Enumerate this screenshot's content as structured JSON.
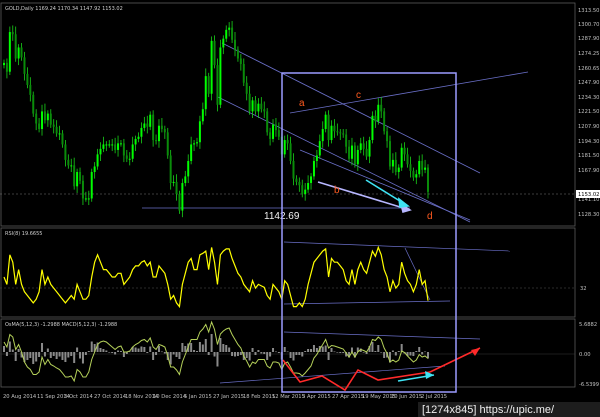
{
  "chart_data": [
    {
      "type": "candlestick",
      "header": "GOLD,Daily  1169.24 1170.34 1147.92 1153.02",
      "y_ticks": [
        "1313.50",
        "1300.70",
        "1287.90",
        "1274.25",
        "1260.65",
        "1247.90",
        "1234.30",
        "1221.50",
        "1207.90",
        "1194.30",
        "1181.50",
        "1167.90",
        "1153.02",
        "1141.10",
        "1128.30"
      ],
      "current_price": "1153.02",
      "ylim": [
        1122,
        1318
      ],
      "annotation_price": "1142.69",
      "wave_labels": [
        "a",
        "b",
        "c",
        "d"
      ],
      "series": [
        {
          "name": "GOLD",
          "close": [
            1270,
            1262,
            1298,
            1296,
            1274,
            1284,
            1275,
            1260,
            1250,
            1241,
            1224,
            1215,
            1210,
            1226,
            1218,
            1224,
            1214,
            1212,
            1206,
            1206,
            1196,
            1182,
            1177,
            1177,
            1158,
            1171,
            1163,
            1147,
            1147,
            1147,
            1171,
            1176,
            1187,
            1192,
            1196,
            1196,
            1196,
            1196,
            1191,
            1197,
            1197,
            1186,
            1183,
            1183,
            1196,
            1201,
            1203,
            1211,
            1215,
            1212,
            1223,
            1200,
            1199,
            1213,
            1210,
            1207,
            1186,
            1161,
            1162,
            1151,
            1136,
            1161,
            1167,
            1181,
            1196,
            1197,
            1198,
            1217,
            1228,
            1258,
            1242,
            1290,
            1268,
            1232,
            1284,
            1292,
            1300,
            1302,
            1291,
            1282,
            1274,
            1269,
            1252,
            1242,
            1226,
            1236,
            1226,
            1233,
            1228,
            1226,
            1207,
            1201,
            1214,
            1209,
            1203,
            1187,
            1200,
            1197,
            1181,
            1165,
            1162,
            1159,
            1151,
            1155,
            1161,
            1167,
            1181,
            1186,
            1199,
            1210,
            1223,
            1200,
            1213,
            1208,
            1207,
            1206,
            1205,
            1194,
            1183,
            1195,
            1178,
            1191,
            1197,
            1192,
            1185,
            1200,
            1222,
            1217,
            1232,
            1226,
            1208,
            1199,
            1176,
            1182,
            1171,
            1175,
            1193,
            1187,
            1178,
            1172,
            1166,
            1169,
            1181,
            1173,
            1175,
            1153
          ]
        }
      ],
      "x_ticks": [
        "20 Aug 2014",
        "11 Sep 2014",
        "3 Oct 2014",
        "27 Oct 2014",
        "18 Nov 2014",
        "10 Dec 2014",
        "5 Jan 2015",
        "27 Jan 2015",
        "18 Feb 2015",
        "12 Mar 2015",
        "3 Apr 2015",
        "27 Apr 2015",
        "19 May 2015",
        "10 Jun 2015",
        "2 Jul 2015"
      ]
    },
    {
      "type": "line",
      "header": "RSI(8) 19.6655",
      "level": "32",
      "ylim": [
        0,
        100
      ],
      "series": [
        {
          "name": "RSI(8)",
          "values": [
            50,
            40,
            80,
            70,
            40,
            60,
            40,
            30,
            25,
            20,
            15,
            20,
            30,
            60,
            40,
            50,
            40,
            35,
            30,
            25,
            20,
            15,
            20,
            25,
            20,
            40,
            30,
            20,
            20,
            25,
            50,
            70,
            80,
            70,
            60,
            60,
            55,
            50,
            50,
            55,
            55,
            40,
            45,
            50,
            60,
            65,
            65,
            70,
            72,
            65,
            70,
            50,
            50,
            65,
            60,
            55,
            40,
            20,
            25,
            15,
            10,
            40,
            55,
            70,
            75,
            60,
            60,
            80,
            82,
            85,
            60,
            90,
            70,
            40,
            80,
            85,
            88,
            88,
            75,
            65,
            55,
            50,
            40,
            35,
            30,
            45,
            35,
            40,
            38,
            36,
            25,
            20,
            40,
            35,
            30,
            20,
            45,
            40,
            25,
            10,
            10,
            15,
            10,
            20,
            40,
            55,
            70,
            75,
            80,
            85,
            88,
            50,
            75,
            70,
            70,
            65,
            60,
            45,
            40,
            60,
            40,
            60,
            70,
            60,
            55,
            70,
            85,
            78,
            90,
            80,
            60,
            50,
            30,
            45,
            35,
            40,
            70,
            55,
            45,
            40,
            30,
            40,
            60,
            40,
            45,
            18
          ]
        }
      ]
    },
    {
      "type": "histogram",
      "header": "OsMA(5,12,3) -1.2988  MACD(5,12,3) -1.2988",
      "y_ticks": [
        "5.6882",
        "0.00",
        "-6.5399"
      ],
      "ylim": [
        -6.8,
        6.0
      ],
      "series": [
        {
          "name": "OsMA",
          "values": [
            1.2,
            -0.8,
            2.1,
            0.5,
            -1.8,
            0.6,
            -1.1,
            -2.0,
            -1.6,
            -1.2,
            -2.4,
            -1.9,
            -1.0,
            1.8,
            -0.9,
            0.7,
            -1.2,
            -0.8,
            -1.4,
            -0.9,
            -1.6,
            -2.0,
            -1.1,
            -0.8,
            -2.2,
            0.9,
            -1.3,
            -2.3,
            -0.6,
            0.2,
            2.1,
            1.6,
            1.9,
            0.8,
            0.6,
            0.3,
            -0.1,
            -0.2,
            -0.5,
            0.3,
            0.2,
            -1.0,
            -0.4,
            0.1,
            1.0,
            0.9,
            0.7,
            1.1,
            1.0,
            -0.2,
            1.1,
            -1.6,
            -0.6,
            1.2,
            0.1,
            -0.3,
            -1.6,
            -2.5,
            -0.5,
            -1.0,
            -1.4,
            1.8,
            1.2,
            1.7,
            1.8,
            0.4,
            0.2,
            2.0,
            1.5,
            2.6,
            -0.6,
            3.6,
            -0.9,
            -2.9,
            2.8,
            1.6,
            1.4,
            0.9,
            -0.8,
            -0.9,
            -0.8,
            -0.6,
            -1.6,
            -1.2,
            -1.7,
            0.8,
            -0.6,
            0.4,
            -0.3,
            -0.4,
            -1.6,
            -0.9,
            0.8,
            0.1,
            -0.2,
            -1.5,
            1.0,
            0.1,
            -1.2,
            -1.7,
            -0.6,
            -0.6,
            -0.9,
            0.2,
            0.6,
            0.6,
            1.4,
            0.8,
            1.2,
            1.1,
            1.3,
            -1.6,
            0.8,
            0.1,
            0.0,
            -0.2,
            -0.2,
            -0.9,
            -1.1,
            0.9,
            -1.1,
            0.9,
            0.7,
            -0.1,
            -0.4,
            1.2,
            2.0,
            0.2,
            1.4,
            0.0,
            -1.2,
            -1.1,
            -2.1,
            0.3,
            -0.7,
            0.2,
            1.6,
            -0.3,
            -0.8,
            -0.7,
            -0.8,
            0.2,
            1.0,
            -0.5,
            0.1,
            -1.3
          ]
        },
        {
          "name": "MACD",
          "values": [
            2.0,
            1.0,
            3.5,
            3.0,
            0.5,
            1.5,
            0.0,
            -2.0,
            -3.0,
            -3.5,
            -4.5,
            -4.5,
            -4.0,
            -1.0,
            -2.5,
            -1.5,
            -2.5,
            -2.8,
            -3.2,
            -3.5,
            -4.2,
            -5.0,
            -5.0,
            -4.8,
            -5.8,
            -3.5,
            -4.0,
            -5.0,
            -5.0,
            -4.0,
            -1.5,
            0.0,
            1.5,
            2.0,
            2.2,
            2.0,
            1.5,
            1.0,
            0.5,
            1.0,
            1.2,
            0.0,
            0.0,
            0.2,
            1.0,
            1.5,
            1.8,
            2.3,
            2.5,
            2.0,
            2.8,
            1.0,
            0.5,
            1.5,
            1.3,
            1.0,
            -0.8,
            -3.0,
            -3.0,
            -3.6,
            -4.5,
            -2.0,
            -0.5,
            1.0,
            2.5,
            2.5,
            2.5,
            4.0,
            4.6,
            5.5,
            4.0,
            6.0,
            4.5,
            1.5,
            3.6,
            4.2,
            4.6,
            4.8,
            3.5,
            2.5,
            1.5,
            0.8,
            -0.8,
            -1.8,
            -3.0,
            -2.0,
            -2.3,
            -1.5,
            -1.5,
            -1.5,
            -2.8,
            -3.2,
            -2.0,
            -2.0,
            -2.2,
            -3.5,
            -2.2,
            -2.0,
            -3.0,
            -4.2,
            -4.2,
            -4.3,
            -4.8,
            -4.2,
            -3.5,
            -2.8,
            -1.2,
            -0.5,
            0.6,
            1.5,
            2.5,
            0.8,
            1.3,
            1.2,
            1.0,
            0.8,
            0.6,
            -0.2,
            -1.0,
            0.0,
            -1.0,
            0.0,
            0.5,
            0.3,
            0.0,
            1.0,
            2.5,
            2.3,
            3.0,
            2.5,
            0.8,
            -0.3,
            -2.0,
            -1.6,
            -2.0,
            -1.6,
            0.2,
            -0.1,
            -0.8,
            -1.4,
            -2.0,
            -1.6,
            -0.5,
            -1.0,
            -0.8,
            -1.3
          ]
        }
      ]
    }
  ],
  "watermark": "[1274x845] https://upic.me/"
}
